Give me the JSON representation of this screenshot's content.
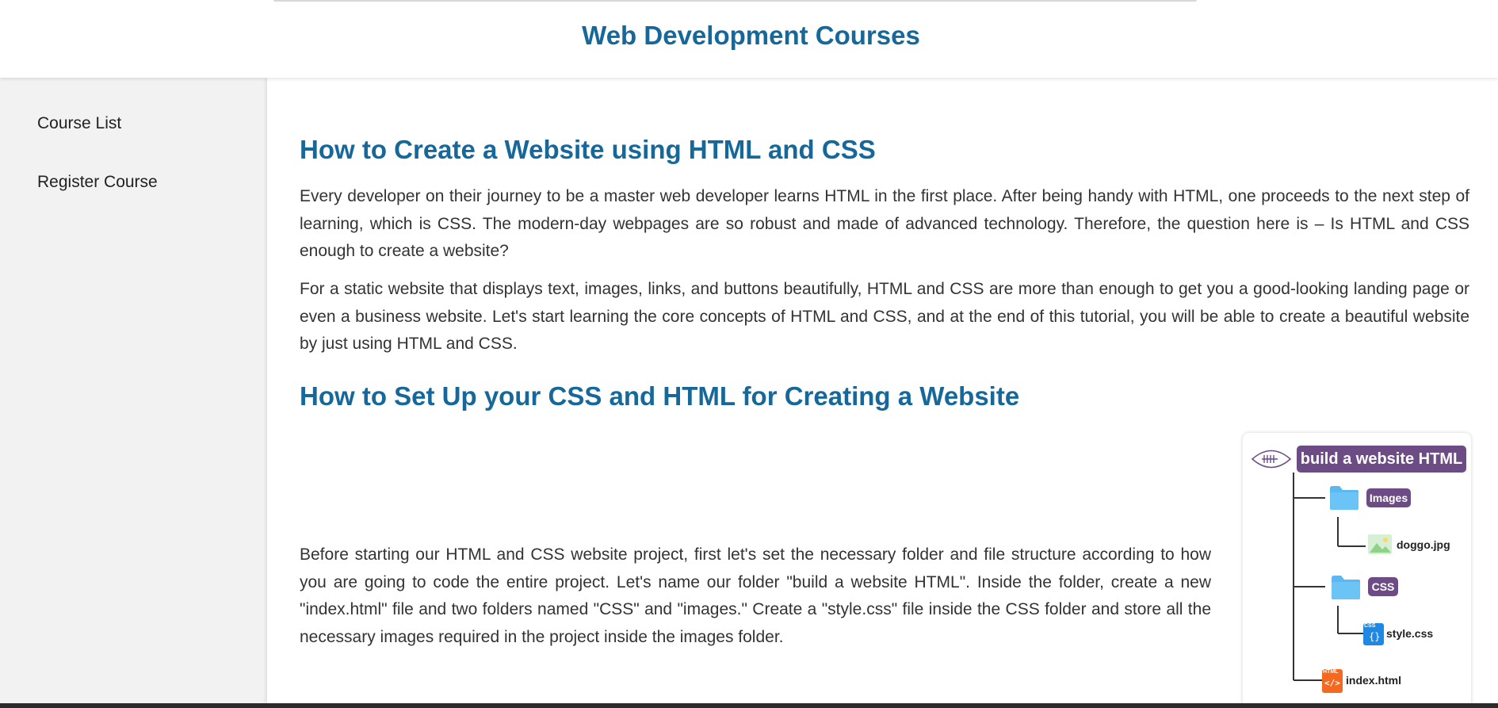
{
  "header": {
    "title": "Web Development Courses"
  },
  "sidebar": {
    "items": [
      {
        "label": "Course List"
      },
      {
        "label": "Register Course"
      }
    ]
  },
  "main": {
    "section1": {
      "heading": "How to Create a Website using HTML and CSS",
      "paragraphs": [
        "Every developer on their journey to be a master web developer learns HTML in the first place. After being handy with HTML, one proceeds to the next step of learning, which is CSS. The modern-day webpages are so robust and made of advanced technology. Therefore, the question here is – Is HTML and CSS enough to create a website?",
        "For a static website that displays text, images, links, and buttons beautifully, HTML and CSS are more than enough to get you a good-looking landing page or even a business website. Let's start learning the core concepts of HTML and CSS, and at the end of this tutorial, you will be able to create a beautiful website by just using HTML and CSS."
      ]
    },
    "section2": {
      "heading": "How to Set Up your CSS and HTML for Creating a Website",
      "paragraph": "Before starting our HTML and CSS website project, first let's set the necessary folder and file structure according to how you are going to code the entire project. Let's name our folder \"build a website HTML\". Inside the folder, create a new \"index.html\" file and two folders named \"CSS\" and \"images.\" Create a \"style.css\" file inside the CSS folder and store all the necessary images required in the project inside the images folder."
    },
    "figure": {
      "root_label": "build a website HTML",
      "images_folder": "Images",
      "image_file": "doggo.jpg",
      "css_folder": "CSS",
      "css_file": "style.css",
      "html_file": "index.html",
      "css_badge": "CSS",
      "html_badge": "HTML",
      "icons": [
        "football-icon",
        "folder-icon",
        "image-file-icon",
        "css-file-icon",
        "html-file-icon"
      ],
      "colors": {
        "pill": "#6d4c86",
        "folder": "#5bb8f0",
        "css_file": "#1e88e5",
        "html_file": "#f4691f"
      }
    }
  },
  "colors": {
    "heading": "#16689b",
    "text": "#333333",
    "sidebar_bg": "#f2f2f2"
  }
}
